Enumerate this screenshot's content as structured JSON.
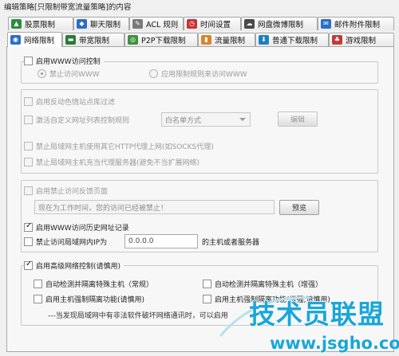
{
  "window": {
    "title": "编辑策略[只限制带宽流量策略]的内容"
  },
  "tabs_top": [
    {
      "label": "股票限制",
      "icon": "stock-icon",
      "color": "#2c8c3c"
    },
    {
      "label": "聊天限制",
      "icon": "chat-icon",
      "color": "#2a6fc6"
    },
    {
      "label": "ACL 规则",
      "icon": "acl-icon",
      "color": "#7a7a7a"
    },
    {
      "label": "时间设置",
      "icon": "clock-icon",
      "color": "#c83232"
    },
    {
      "label": "网盘微博限制",
      "icon": "cloud-icon",
      "color": "#4a4a4a"
    },
    {
      "label": "邮件附件限制",
      "icon": "mail-icon",
      "color": "#2a6fc6"
    }
  ],
  "tabs_bottom": [
    {
      "label": "网络限制",
      "icon": "network-icon",
      "color": "#2a6fc6",
      "active": true
    },
    {
      "label": "带宽限制",
      "icon": "bandwidth-icon",
      "color": "#2c7a3a"
    },
    {
      "label": "P2P下载限制",
      "icon": "p2p-icon",
      "color": "#3f8f3f"
    },
    {
      "label": "流量限制",
      "icon": "traffic-icon",
      "color": "#d6862a"
    },
    {
      "label": "普通下载限制",
      "icon": "download-icon",
      "color": "#1e7fc2"
    },
    {
      "label": "游戏限制",
      "icon": "game-icon",
      "color": "#c23a3a"
    }
  ],
  "www": {
    "enable_label": "启用WWW访问控制",
    "enabled": false,
    "radio_block": "禁止访问WWW",
    "radio_rule": "应用限制规则来访问WWW",
    "selected": "block"
  },
  "filters": {
    "reverse_color_label": "启用反动色情站点库过滤",
    "custom_url_label": "激活自定义网址列表控制规则",
    "list_mode_value": "白名单方式",
    "edit_button": "编辑",
    "proxy_usage_label": "禁止局域网主机使用其它HTTP代理上网(如SOCKS代理)",
    "proxy_server_label": "禁止局域网主机充当代理服务器(避免不当扩展网络)"
  },
  "feedback": {
    "enable_label": "启用禁止访问反馈页面",
    "message_value": "现在为工作时间，您的访问已经被禁止！",
    "preview_button": "预览"
  },
  "history": {
    "label": "启用WWW访问历史网址记录",
    "checked": true
  },
  "block_ip": {
    "label": "禁止访问局域网内IP为",
    "ip_value": "0.0.0.0",
    "suffix": "的主机或者服务器",
    "checked": false
  },
  "advanced": {
    "enable_label": "启用高级网络控制(请慎用)",
    "checked": true,
    "option1": "自动检测并隔离特殊主机（常规）",
    "option2": "自动检测并隔离特殊主机（增强）",
    "option3": "启用主机强制隔离功能(请慎用)",
    "option4": "启用主机强制隔离功能(增强,请慎用)",
    "note": "---当发现局域网中有非法软件破坏网络通讯时，可以启用"
  },
  "watermark": {
    "text": "技术员联盟",
    "url": "www.jsgho.com"
  }
}
